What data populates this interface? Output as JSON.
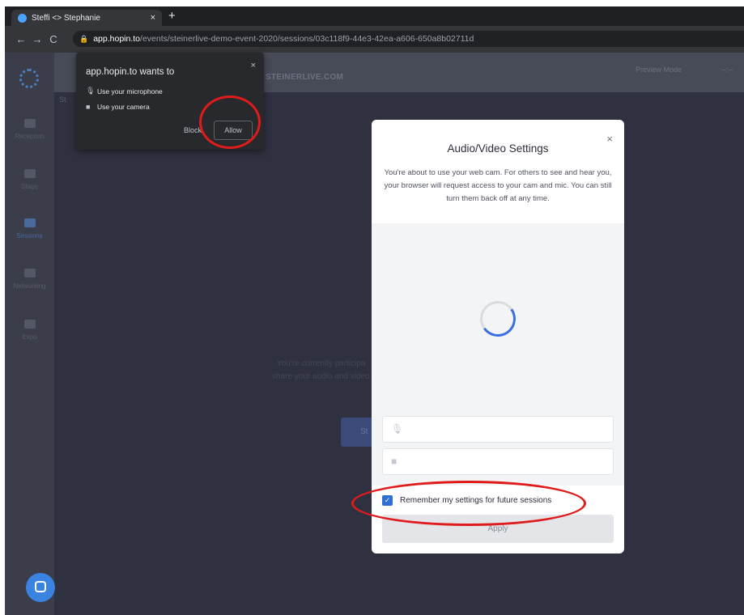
{
  "browser": {
    "tab_title": "Steffi <> Stephanie",
    "tab_close": "×",
    "new_tab": "+",
    "back": "←",
    "forward": "→",
    "reload": "C",
    "url_host": "app.hopin.to",
    "url_path": "/events/steinerlive-demo-event-2020/sessions/03c118f9-44e3-42ea-a606-650a8b02711d"
  },
  "app": {
    "brand": "STEINERLIVE.COM",
    "preview_mode": "Preview Mode",
    "clock": "--:--",
    "breadcrumb": "St",
    "sidebar": [
      {
        "label": "Reception",
        "active": false
      },
      {
        "label": "Stage",
        "active": false
      },
      {
        "label": "Sessions",
        "active": true
      },
      {
        "label": "Networking",
        "active": false
      },
      {
        "label": "Expo",
        "active": false
      }
    ],
    "background_text_1": "You're currently participa",
    "background_text_2": "share your audio and video",
    "background_button": "St"
  },
  "permission_prompt": {
    "heading": "app.hopin.to wants to",
    "close": "×",
    "mic_label": "Use your microphone",
    "camera_label": "Use your camera",
    "block_label": "Block",
    "allow_label": "Allow"
  },
  "modal": {
    "close": "×",
    "title": "Audio/Video Settings",
    "description": "You're about to use your web cam. For others to see and hear you, your browser will request access to your cam and mic. You can still turn them back off at any time.",
    "mic_select_icon": "microphone-icon",
    "camera_select_icon": "camera-icon",
    "remember_label": "Remember my settings for future sessions",
    "remember_checked": true,
    "apply_label": "Apply"
  },
  "colors": {
    "annotation_red": "#e01b1b",
    "accent_blue": "#2f6ed8",
    "app_background": "#2f3140"
  }
}
